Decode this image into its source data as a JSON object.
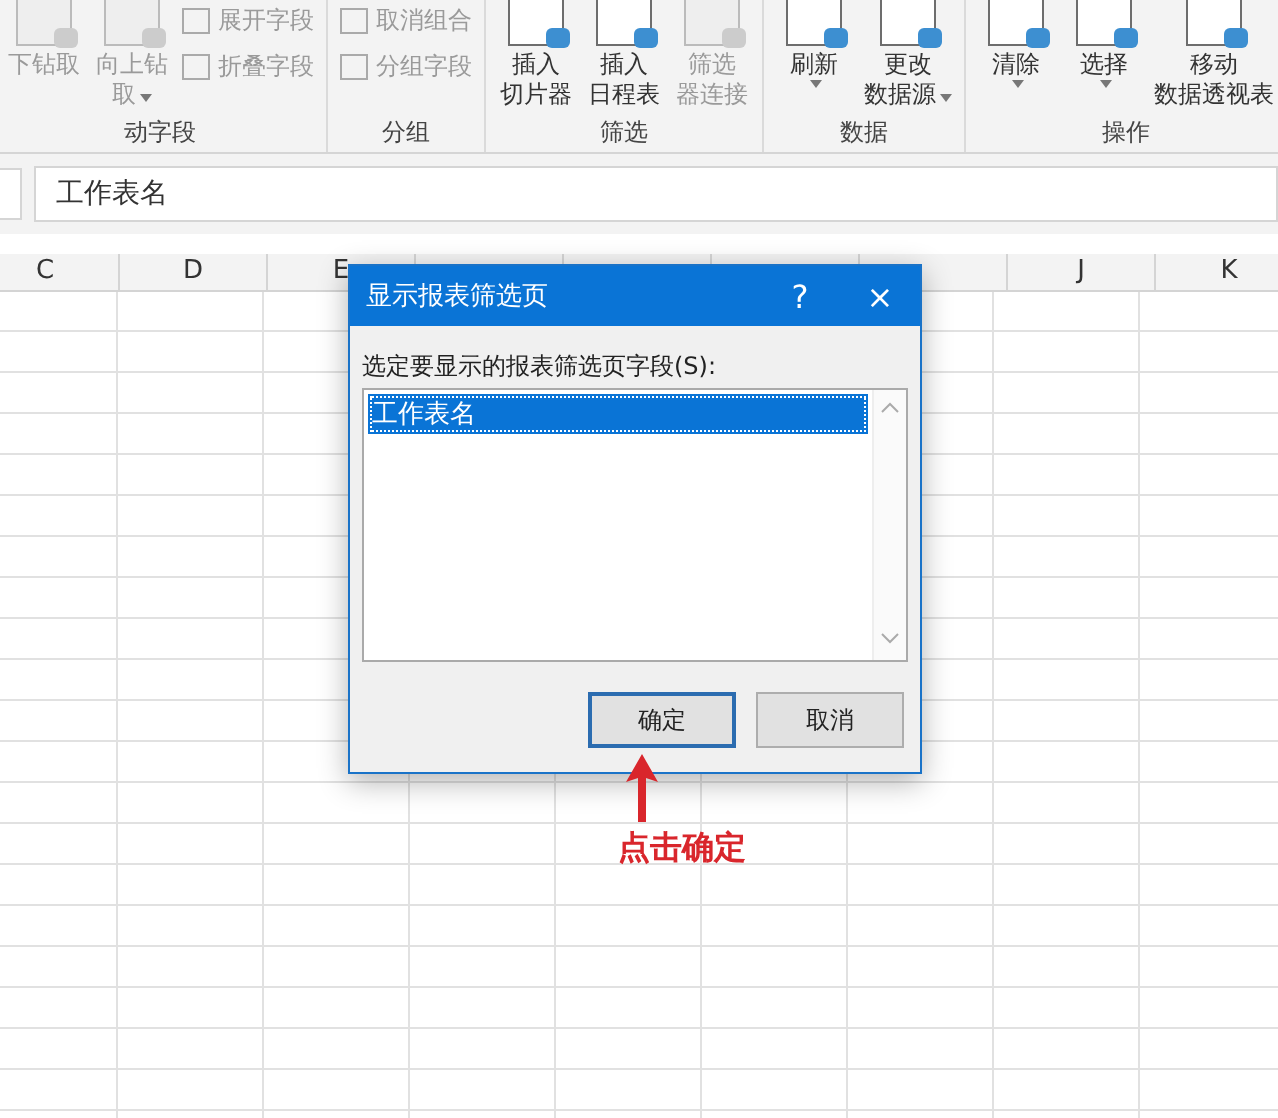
{
  "ribbon": {
    "groups": [
      {
        "label": "动字段",
        "large": [
          {
            "lines": [
              "下钻取"
            ],
            "caret": false,
            "disabled": true
          },
          {
            "lines": [
              "向上钻",
              "取"
            ],
            "caret": true,
            "disabled": true
          }
        ],
        "small": [
          {
            "label": "展开字段",
            "disabled": true
          },
          {
            "label": "折叠字段",
            "disabled": true
          }
        ]
      },
      {
        "label": "分组",
        "small": [
          {
            "label": "取消组合",
            "disabled": true
          },
          {
            "label": "分组字段",
            "disabled": true
          }
        ]
      },
      {
        "label": "筛选",
        "large": [
          {
            "lines": [
              "插入",
              "切片器"
            ],
            "caret": false,
            "disabled": false
          },
          {
            "lines": [
              "插入",
              "日程表"
            ],
            "caret": false,
            "disabled": false
          },
          {
            "lines": [
              "筛选",
              "器连接"
            ],
            "caret": false,
            "disabled": true
          }
        ]
      },
      {
        "label": "数据",
        "large": [
          {
            "lines": [
              "刷新"
            ],
            "caret": true,
            "disabled": false
          },
          {
            "lines": [
              "更改",
              "数据源"
            ],
            "caret": true,
            "disabled": false
          }
        ]
      },
      {
        "label": "操作",
        "large": [
          {
            "lines": [
              "清除"
            ],
            "caret": true,
            "disabled": false
          },
          {
            "lines": [
              "选择"
            ],
            "caret": true,
            "disabled": false
          },
          {
            "lines": [
              "移动",
              "数据透视表"
            ],
            "caret": false,
            "disabled": false
          }
        ]
      }
    ]
  },
  "formula_bar": {
    "value": "工作表名"
  },
  "columns": [
    "C",
    "D",
    "E",
    "",
    "",
    "",
    "",
    "J",
    "K"
  ],
  "dialog": {
    "title": "显示报表筛选页",
    "help": "?",
    "close": "×",
    "prompt": "选定要显示的报表筛选页字段(S):",
    "items": [
      {
        "label": "工作表名",
        "selected": true
      }
    ],
    "buttons": [
      {
        "label": "确定",
        "default": true
      },
      {
        "label": "取消",
        "default": false
      }
    ]
  },
  "annotation": {
    "text": "点击确定"
  }
}
